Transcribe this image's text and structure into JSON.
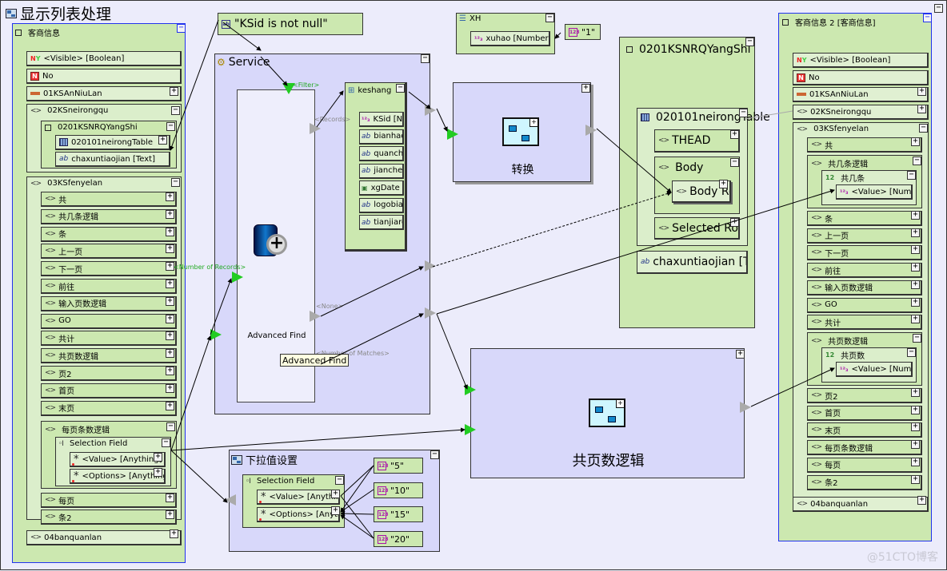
{
  "title": "显示列表处理",
  "left_panel": {
    "title": "客商信息",
    "items": [
      {
        "icon": "visible-boolean-icon",
        "label": "<Visible> [Boolean]"
      },
      {
        "icon": "no-icon",
        "label": "No"
      },
      {
        "icon": "bar-icon",
        "label": "01KSAnNiuLan"
      },
      {
        "icon": "tag-icon",
        "label": "02KSneirongqu",
        "child": {
          "label": "0201KSNRQYangShi",
          "items": [
            {
              "icon": "table-icon",
              "label": "020101neirongTable"
            },
            {
              "icon": "text-icon",
              "label": "chaxuntiaojian [Text]"
            }
          ]
        }
      },
      {
        "icon": "tag-icon",
        "label": "03KSfenyelan"
      }
    ],
    "fenyelan_items": [
      "共",
      "共几条逻辑",
      "条",
      "上一页",
      "下一页",
      "前往",
      "输入页数逻辑",
      "GO",
      "共计",
      "共页数逻辑",
      "页2",
      "首页",
      "末页"
    ],
    "meiye_logic": {
      "label": "每页条数逻辑",
      "selection_field": "Selection Field",
      "value": "<Value> [Anything]",
      "options": "<Options> [Anything]"
    },
    "after_items": [
      "每页",
      "条2"
    ],
    "footer_item": "04banquanlan"
  },
  "filter_const": "\"KSid is not null\"",
  "service": {
    "title": "Service",
    "filter_label": "<Filter>",
    "records_label": "<Records>",
    "number_of_records_label": "<Number of Records>",
    "none_label": "<None>",
    "number_of_matches_label": "<Number of Matches>",
    "advanced_find_label": "Advanced Find",
    "tooltip": "Advanced Find",
    "keshang": {
      "title": "keshang",
      "fields": [
        {
          "icon": "number-icon",
          "label": "KSid [Number]"
        },
        {
          "icon": "text-icon",
          "label": "bianhao"
        },
        {
          "icon": "text-icon",
          "label": "quanche"
        },
        {
          "icon": "text-icon",
          "label": "jianchen"
        },
        {
          "icon": "date-icon",
          "label": "xgDate ["
        },
        {
          "icon": "text-icon",
          "label": "logobiao"
        },
        {
          "icon": "text-icon",
          "label": "tianjiaren"
        }
      ]
    }
  },
  "xh": {
    "title": "XH",
    "field": "xuhao [Number]",
    "const": "\"1\""
  },
  "zhuanhuan": {
    "label": "转换"
  },
  "gongyeshu": {
    "label": "共页数逻辑"
  },
  "yangshi_panel": {
    "title": "0201KSNRQYangShi",
    "table": "020101neirongTable",
    "thead": "THEAD",
    "body": "Body",
    "body_row": "Body Row",
    "selected_row": "Selected Row",
    "text_field": "chaxuntiaojian [Text]"
  },
  "dropdown": {
    "title": "下拉值设置",
    "selection_field": "Selection Field",
    "value": "<Value> [Anything]",
    "options": "<Options> [Anything]",
    "consts": [
      "\"5\"",
      "\"10\"",
      "\"15\"",
      "\"20\""
    ]
  },
  "right_panel": {
    "title": "客商信息 2 [客商信息]",
    "items": [
      "<Visible> [Boolean]",
      "No",
      "01KSAnNiuLan",
      "02KSneirongqu",
      "03KSfenyelan"
    ],
    "fenyelan_first": "共",
    "gongjitiao_logic": {
      "label": "共几条逻辑",
      "sub": "共几条",
      "value": "<Value> [Number]"
    },
    "mid_items": [
      "条",
      "上一页",
      "下一页",
      "前往",
      "输入页数逻辑",
      "GO",
      "共计"
    ],
    "gongyeshu_logic": {
      "label": "共页数逻辑",
      "sub": "共页数",
      "value": "<Value> [Number]"
    },
    "after_items": [
      "页2",
      "首页",
      "末页",
      "每页条数逻辑",
      "每页",
      "条2"
    ],
    "footer_item": "04banquanlan"
  },
  "watermark": "@51CTO博客"
}
